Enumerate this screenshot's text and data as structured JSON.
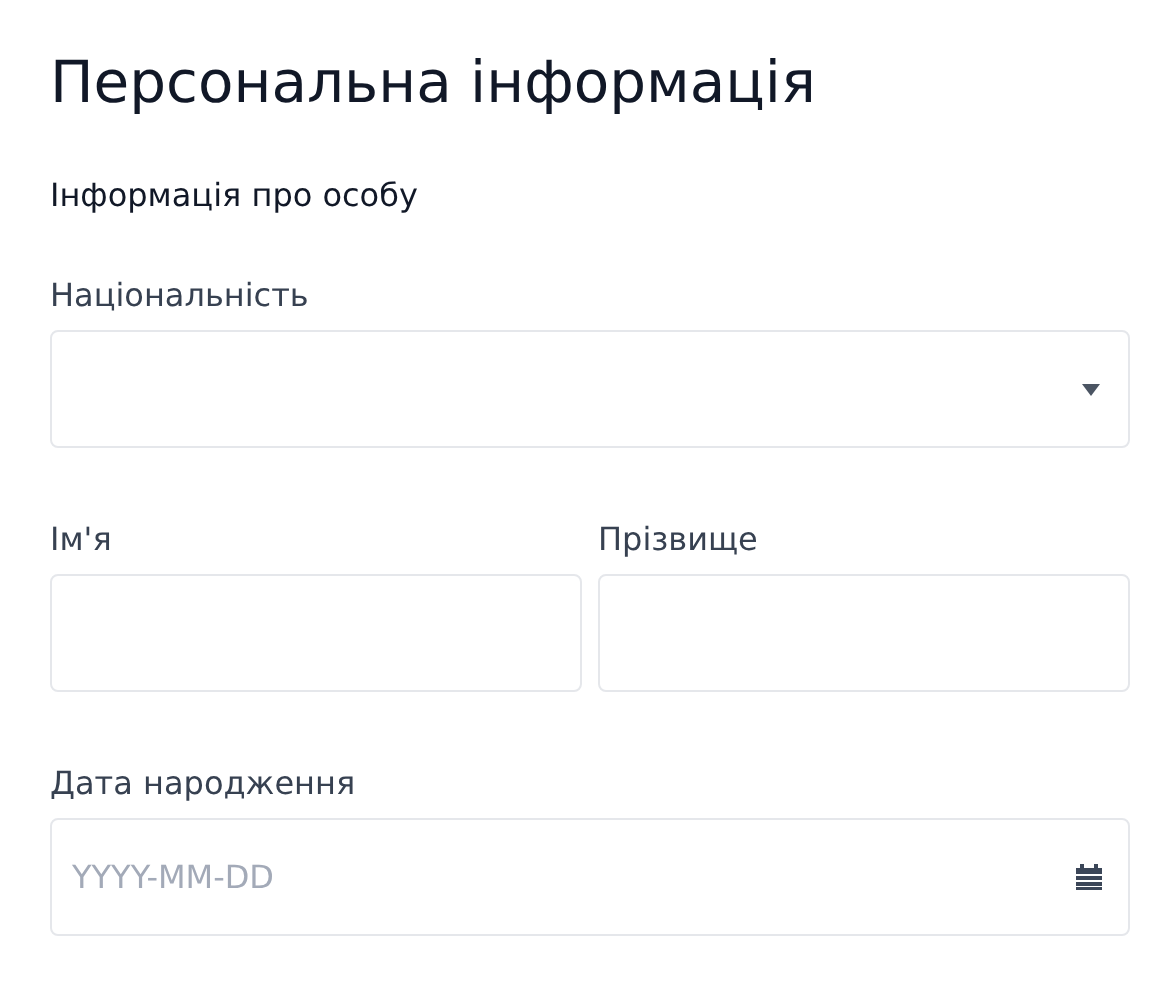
{
  "title": "Персональна інформація",
  "section": "Інформація про особу",
  "fields": [
    {
      "kind": "select",
      "label": "Національність"
    },
    {
      "kind": "text",
      "label": "Ім'я"
    },
    {
      "kind": "text",
      "label": "Прізвище"
    },
    {
      "kind": "date",
      "label": "Дата народження",
      "placeholder": "YYYY-MM-DD"
    }
  ]
}
